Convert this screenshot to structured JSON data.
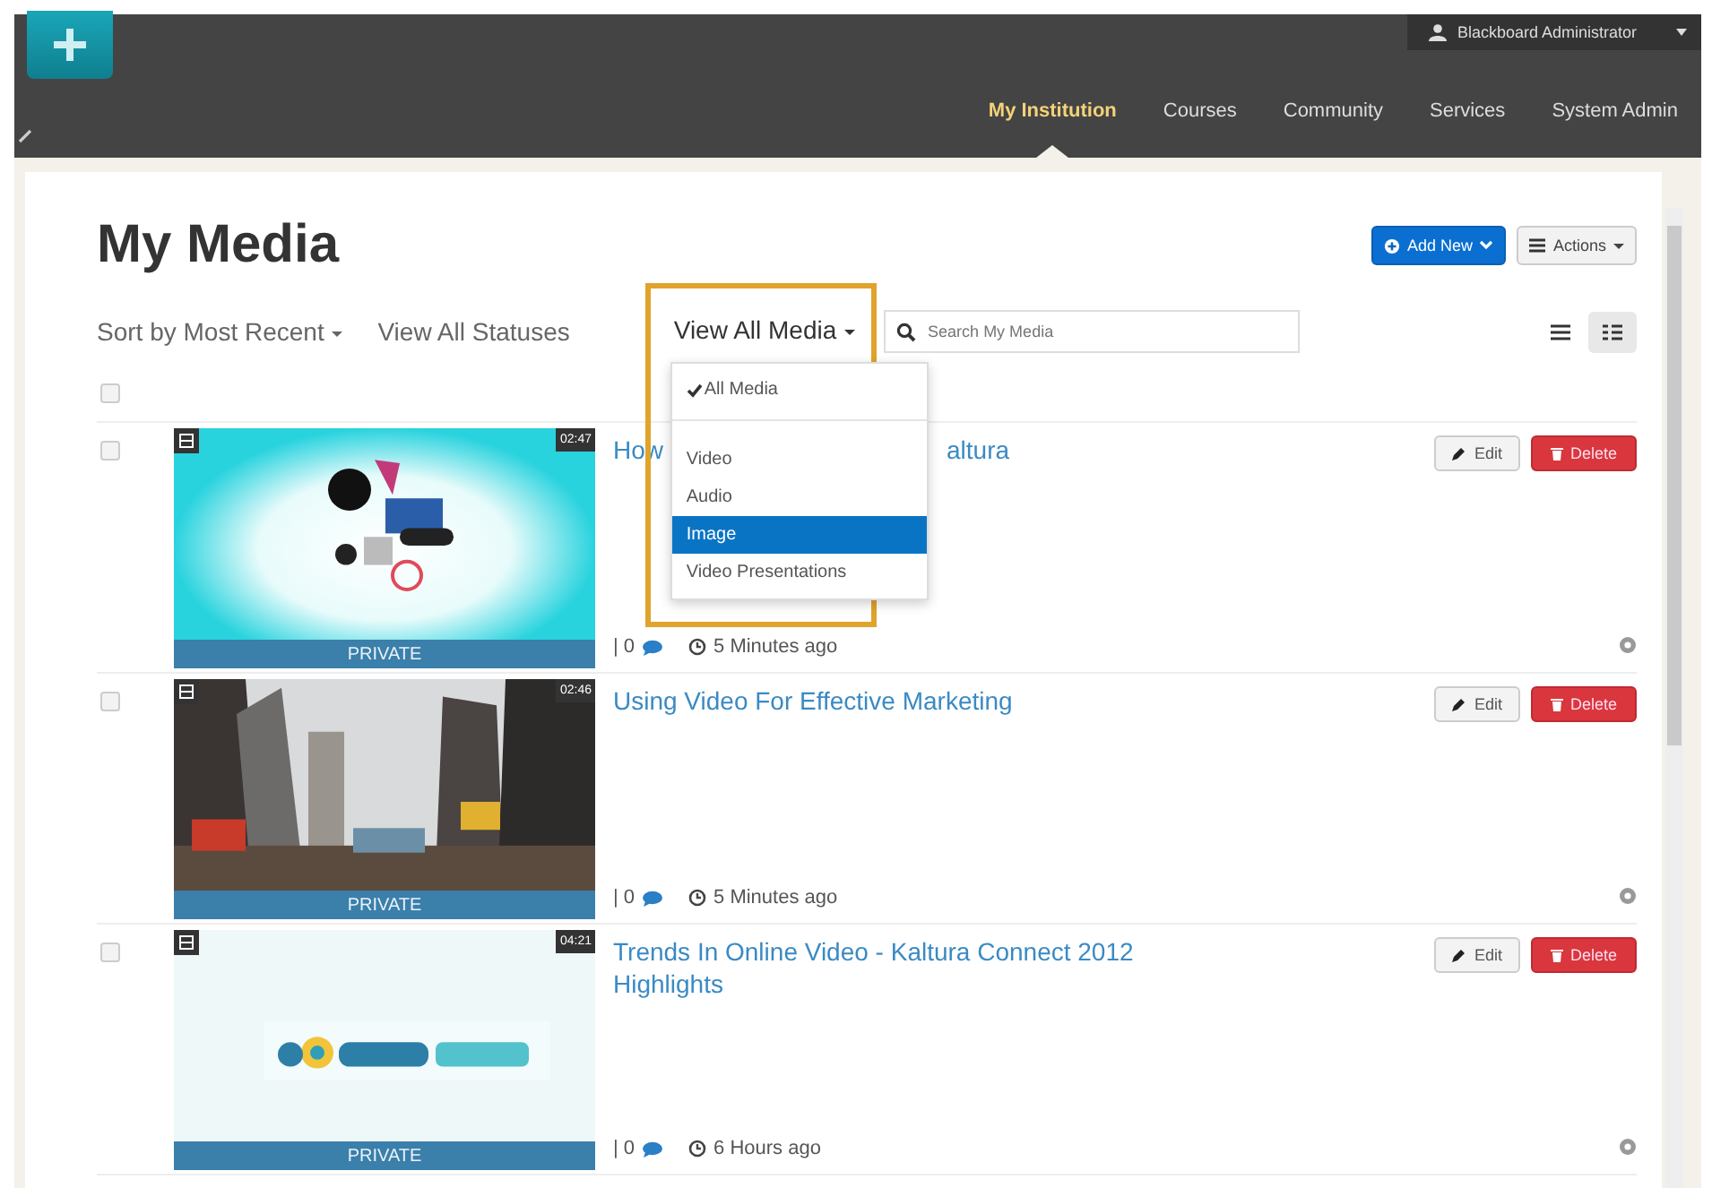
{
  "header": {
    "user": "Blackboard Administrator",
    "tabs": [
      {
        "label": "My Institution",
        "selected": true
      },
      {
        "label": "Courses",
        "selected": false
      },
      {
        "label": "Community",
        "selected": false
      },
      {
        "label": "Services",
        "selected": false
      },
      {
        "label": "System Admin",
        "selected": false
      }
    ]
  },
  "page": {
    "title": "My Media",
    "add_button": "Add New",
    "actions_button": "Actions"
  },
  "filters": {
    "sort": "Sort by Most Recent",
    "statuses": "View All Statuses",
    "media": "View All Media",
    "search": {
      "placeholder": "Search My Media"
    },
    "view_modes": [
      {
        "selected": false
      },
      {
        "selected": true
      }
    ],
    "select_all_checked": false
  },
  "media_menu": {
    "highlighted": true,
    "items": [
      {
        "label": "All Media",
        "checked": true,
        "selected": false
      },
      {
        "label": "Video",
        "checked": false,
        "selected": false
      },
      {
        "label": "Audio",
        "checked": false,
        "selected": false
      },
      {
        "label": "Image",
        "checked": false,
        "selected": true
      },
      {
        "label": "Video Presentations",
        "checked": false,
        "selected": false
      }
    ]
  },
  "entries": [
    {
      "checked": false,
      "title_parts": [
        "How",
        "altura"
      ],
      "duration": "02:47",
      "privacy": "PRIVATE",
      "comments": "| 0",
      "time": "5 Minutes ago",
      "edit": "Edit",
      "delete": "Delete"
    },
    {
      "checked": false,
      "title_parts": [
        "Using Video For Effective Marketing"
      ],
      "duration": "02:46",
      "privacy": "PRIVATE",
      "comments": "| 0",
      "time": "5 Minutes ago",
      "edit": "Edit",
      "delete": "Delete"
    },
    {
      "checked": false,
      "title_parts": [
        "Trends In Online Video - Kaltura Connect 2012 Highlights"
      ],
      "duration": "04:21",
      "privacy": "PRIVATE",
      "comments": "| 0",
      "time": "6 Hours ago",
      "edit": "Edit",
      "delete": "Delete"
    }
  ]
}
